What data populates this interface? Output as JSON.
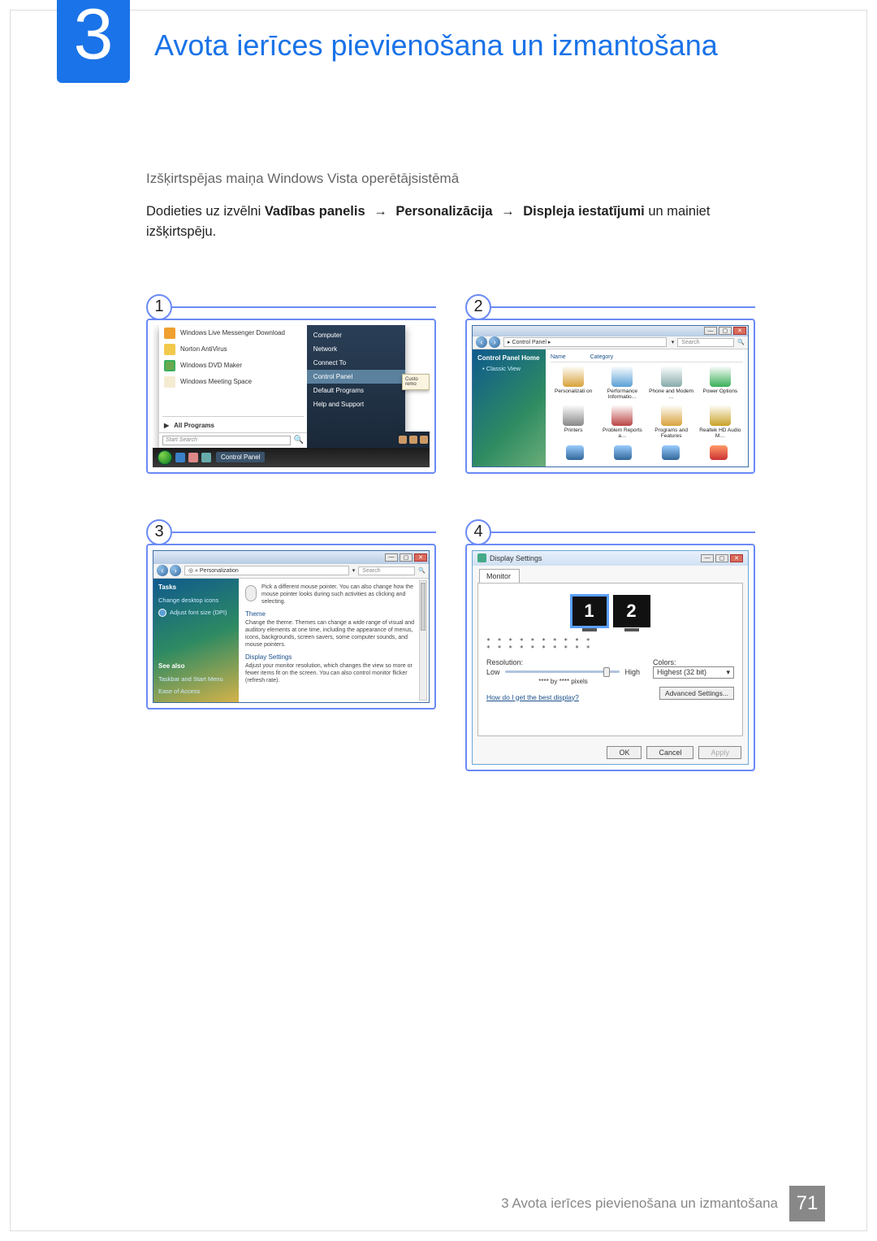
{
  "chapter": {
    "number": "3",
    "title": "Avota ierīces pievienošana un izmantošana"
  },
  "subheading": "Izšķirtspējas maiņa Windows Vista operētājsistēmā",
  "instruction": {
    "pre": "Dodieties uz izvēlni ",
    "path": [
      "Vadības panelis",
      "Personalizācija",
      "Displeja iestatījumi"
    ],
    "post": " un mainiet izšķirtspēju."
  },
  "steps": {
    "s1": "1",
    "s2": "2",
    "s3": "3",
    "s4": "4"
  },
  "fig1": {
    "left_items": [
      "Windows Live Messenger Download",
      "Norton AntiVirus",
      "Windows DVD Maker",
      "Windows Meeting Space"
    ],
    "all_programs": "All Programs",
    "search_placeholder": "Start Search",
    "right_items": [
      "Computer",
      "Network",
      "Connect To",
      "Control Panel",
      "Default Programs",
      "Help and Support"
    ],
    "right_selected_index": 3,
    "taskbar_item": "Control Panel",
    "popup": [
      "Custo",
      "remo"
    ]
  },
  "fig2": {
    "address": "▸ Control Panel ▸",
    "search_placeholder": "Search",
    "side": {
      "title": "Control Panel Home",
      "items": [
        "Classic View"
      ]
    },
    "columns": [
      "Name",
      "Category"
    ],
    "items": [
      "Personalizati on",
      "Performance Informatio…",
      "Phone and Modem …",
      "Power Options",
      "Printers",
      "Problem Reports a…",
      "Programs and Features",
      "Realtek HD Audio M…"
    ],
    "icon_colors": [
      "#d8a23a",
      "#5aa0d6",
      "#8aa",
      "#3aaf5a",
      "#888",
      "#b44",
      "#d8a23a",
      "#c9a227"
    ]
  },
  "fig3": {
    "address": "◎ « Personalization",
    "search_placeholder": "Search",
    "side": {
      "tasks_title": "Tasks",
      "task_links": [
        "Change desktop icons",
        "Adjust font size (DPI)"
      ],
      "see_also_title": "See also",
      "see_also_links": [
        "Taskbar and Start Menu",
        "Ease of Access"
      ]
    },
    "main": {
      "mouse_desc": "Pick a different mouse pointer. You can also change how the mouse pointer looks during such activities as clicking and selecting.",
      "theme_title": "Theme",
      "theme_desc": "Change the theme. Themes can change a wide range of visual and auditory elements at one time, including the appearance of menus, icons, backgrounds, screen savers, some computer sounds, and mouse pointers.",
      "display_title": "Display Settings",
      "display_desc": "Adjust your monitor resolution, which changes the view so more or fewer items fit on the screen. You can also control monitor flicker (refresh rate)."
    }
  },
  "fig4": {
    "title": "Display Settings",
    "tab": "Monitor",
    "monitors": [
      "1",
      "2"
    ],
    "stars1": "* * * * * * * * * *",
    "stars2": "* * * * * * * * * *",
    "resolution_label": "Resolution:",
    "low": "Low",
    "high": "High",
    "pixels_line": "**** by **** pixels",
    "colors_label": "Colors:",
    "colors_value": "Highest (32 bit)",
    "help_link": "How do I get the best display?",
    "advanced": "Advanced Settings...",
    "ok": "OK",
    "cancel": "Cancel",
    "apply": "Apply"
  },
  "footer": {
    "text_prefix": "3 Avota ierīces pievienošana un izmantošana",
    "page": "71"
  }
}
